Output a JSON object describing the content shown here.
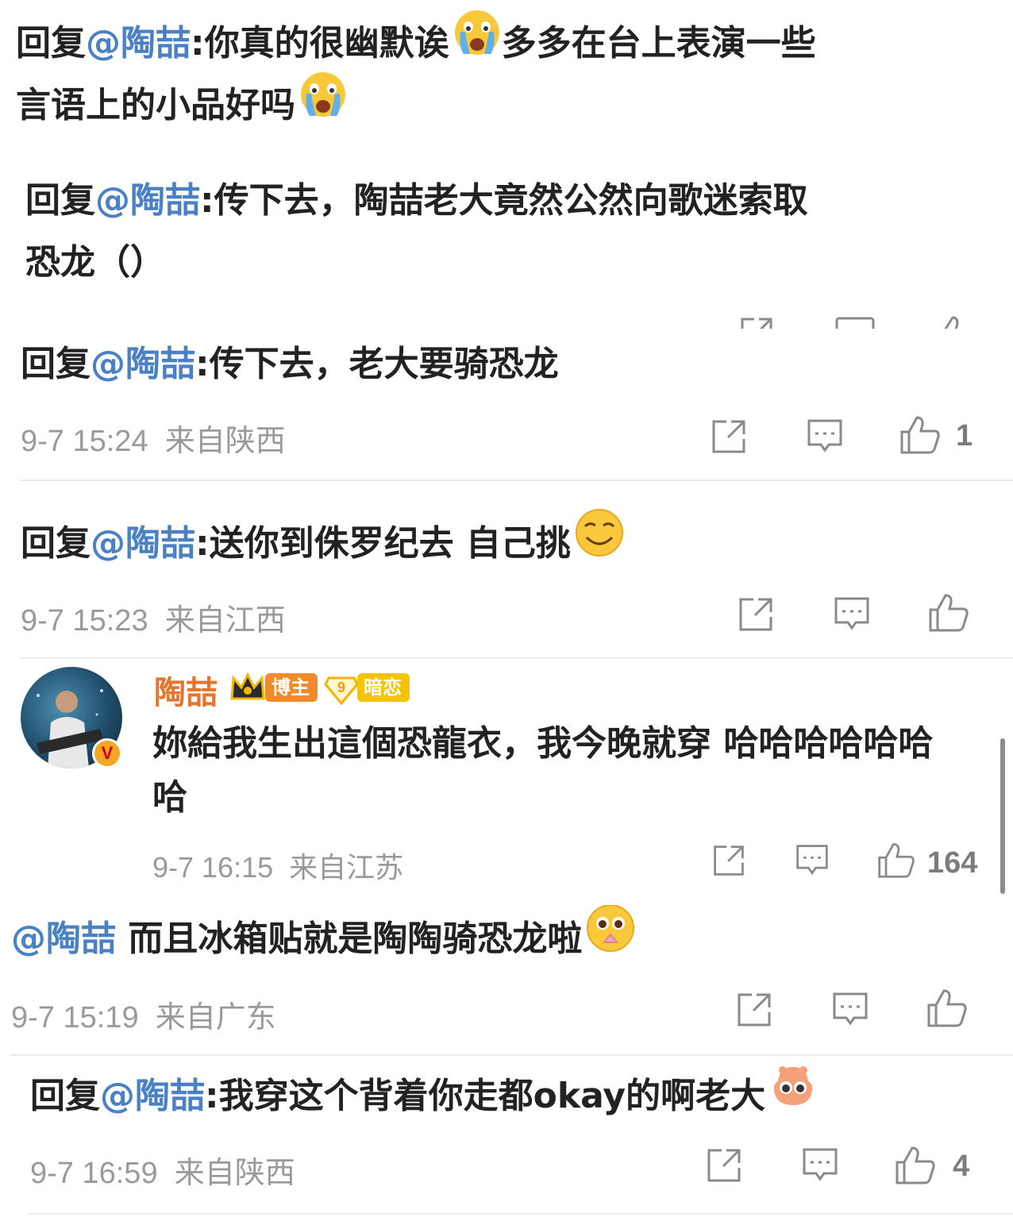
{
  "comments": [
    {
      "prefix": "回复",
      "mention": "@陶喆",
      "line1": ":你真的很幽默诶",
      "line1b": "多多在台上表演一些",
      "line2": "言语上的小品好吗"
    },
    {
      "prefix": "回复",
      "mention": "@陶喆",
      "line1": ":传下去，陶喆老大竟然公然向歌迷索取",
      "line2": "恐龙（）"
    },
    {
      "prefix": "回复",
      "mention": "@陶喆",
      "line1": ":传下去，老大要骑恐龙",
      "time": "9-7 15:24",
      "location": "来自陕西",
      "likes": "1"
    },
    {
      "prefix": "回复",
      "mention": "@陶喆",
      "line1": ":送你到侏罗纪去 自己挑",
      "time": "9-7 15:23",
      "location": "来自江西",
      "likes": ""
    },
    {
      "username": "陶喆",
      "badge1": "博主",
      "badge2": "暗恋",
      "badge2_num": "9",
      "avatar_badge": "V",
      "line1": "妳給我生出這個恐龍衣，我今晚就穿 哈哈哈哈哈哈",
      "line2": "哈",
      "time": "9-7 16:15",
      "location": "来自江苏",
      "likes": "164"
    },
    {
      "mention": "@陶喆",
      "line1": " 而且冰箱贴就是陶陶骑恐龙啦",
      "time": "9-7 15:19",
      "location": "来自广东",
      "likes": ""
    },
    {
      "prefix": "回复",
      "mention": "@陶喆",
      "line1": ":我穿这个背着你走都okay的啊老大",
      "time": "9-7 16:59",
      "location": "来自陕西",
      "likes": "4"
    }
  ],
  "colors": {
    "mention": "#4a80c4",
    "username": "#e8732b",
    "meta": "#9a9a9a"
  },
  "icons": [
    "repost-icon",
    "comment-icon",
    "like-icon",
    "crying-face-emoji",
    "smirk-face-emoji",
    "pleading-face-emoji",
    "shy-face-emoji"
  ]
}
